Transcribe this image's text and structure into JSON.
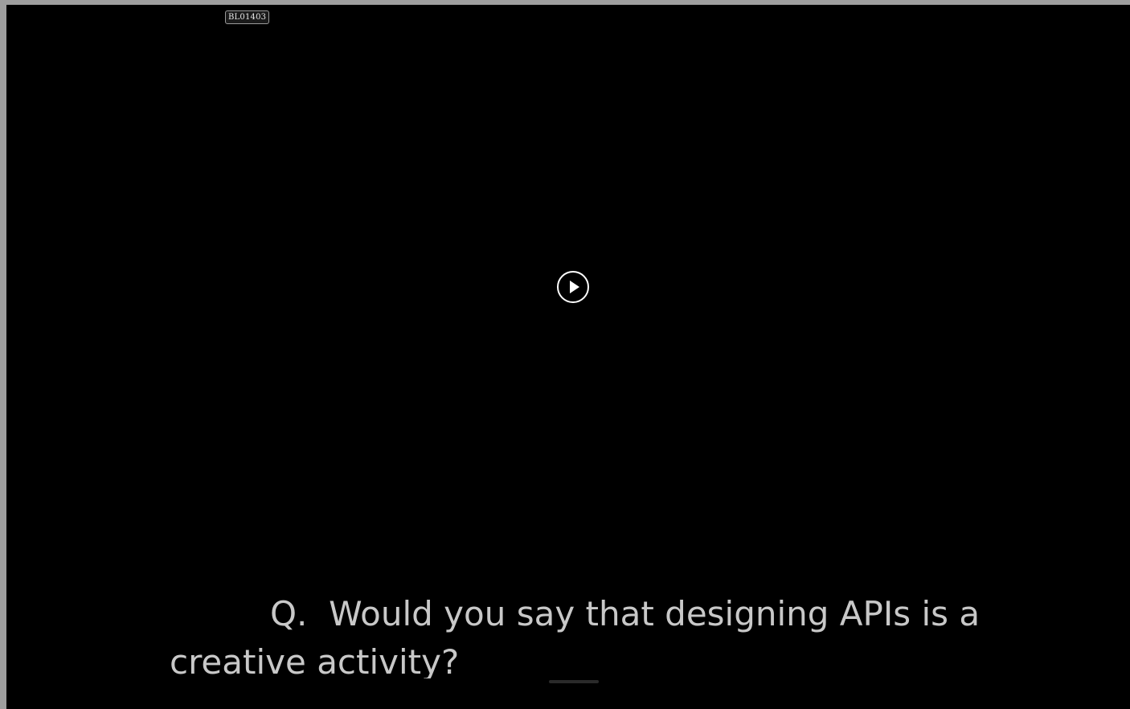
{
  "video": {
    "id_label": "BL01403",
    "play_icon": "play-icon",
    "subtitle": {
      "line1": "Q.  Would you say that designing APIs is a",
      "line2": "creative activity?"
    }
  },
  "colors": {
    "background": "#000000",
    "subtitle_text": "#c8c8c8",
    "frame": "#9e9e9e"
  }
}
